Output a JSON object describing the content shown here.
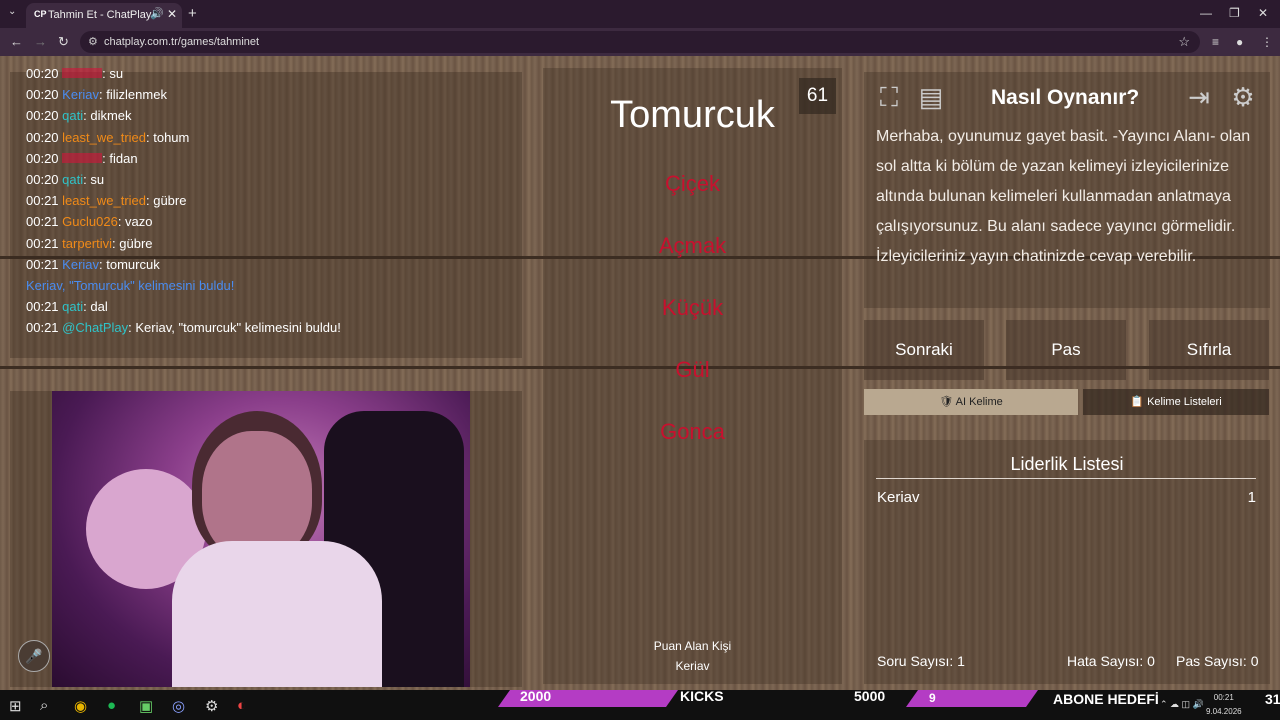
{
  "browser": {
    "tab_favicon": "CP",
    "tab_title": "Tahmin Et - ChatPlay",
    "url": "chatplay.com.tr/games/tahminet"
  },
  "chat": {
    "messages": [
      {
        "time": "00:20",
        "user": "",
        "user_color": "#d2143a",
        "text": ": su"
      },
      {
        "time": "00:20",
        "user": "Keriav",
        "user_color": "#4a8cf0",
        "text": ": filizlenmek"
      },
      {
        "time": "00:20",
        "user": "qati",
        "user_color": "#2fc3c8",
        "text": ": dikmek"
      },
      {
        "time": "00:20",
        "user": "least_we_tried",
        "user_color": "#f08a18",
        "text": ": tohum"
      },
      {
        "time": "00:20",
        "user": "",
        "user_color": "#d2143a",
        "text": ": fidan"
      },
      {
        "time": "00:20",
        "user": "qati",
        "user_color": "#2fc3c8",
        "text": ": su"
      },
      {
        "time": "00:21",
        "user": "least_we_tried",
        "user_color": "#f08a18",
        "text": ": gübre"
      },
      {
        "time": "00:21",
        "user": "Guclu026",
        "user_color": "#f08a18",
        "text": ": vazo"
      },
      {
        "time": "00:21",
        "user": "tarpertivi",
        "user_color": "#f08a18",
        "text": ": gübre"
      },
      {
        "time": "00:21",
        "user": "Keriav",
        "user_color": "#4a8cf0",
        "text": ": tomurcuk"
      },
      {
        "time": "",
        "user": "",
        "user_color": "#4a8cf0",
        "text": "Keriav, \"Tomurcuk\" kelimesini buldu!"
      },
      {
        "time": "00:21",
        "user": "qati",
        "user_color": "#2fc3c8",
        "text": ": dal"
      },
      {
        "time": "00:21",
        "user": "@ChatPlay",
        "user_color": "#2fc3c8",
        "text": ": Keriav, \"tomurcuk\" kelimesini buldu!"
      }
    ]
  },
  "game": {
    "main_word": "Tomurcuk",
    "timer": "61",
    "forbidden_words": [
      "Çiçek",
      "Açmak",
      "Küçük",
      "Gül",
      "Gonca"
    ],
    "scorer_label": "Puan Alan Kişi",
    "scorer_name": "Keriav"
  },
  "howto": {
    "title": "Nasıl Oynanır?",
    "text": "Merhaba, oyunumuz gayet basit. -Yayıncı Alanı- olan sol altta ki bölüm de yazan kelimeyi izleyicilerinize altında bulunan kelimeleri kullanmadan anlatmaya çalışıyorsunuz. Bu alanı sadece yayıncı görmelidir. İzleyicileriniz yayın chatinizde cevap verebilir."
  },
  "controls": {
    "next": "Sonraki",
    "pass": "Pas",
    "reset": "Sıfırla",
    "ai_word": "AI Kelime",
    "word_lists": "Kelime Listeleri"
  },
  "leaderboard": {
    "title": "Liderlik Listesi",
    "entries": [
      {
        "name": "Keriav",
        "score": "1"
      }
    ],
    "question_count": "Soru Sayısı: 1",
    "error_count": "Hata Sayısı: 0",
    "pass_count": "Pas Sayısı: 0"
  },
  "taskbar": {
    "goal1_value": "2000",
    "goal1_label": "KICKS",
    "goal1_target": "5000",
    "goal2_value": "9",
    "goal2_label": "ABONE HEDEFİ",
    "goal2_target": "31",
    "clock_time": "00:21",
    "clock_date": "9.04.2026"
  },
  "colors": {
    "forbidden": "#c8102e",
    "goal_bar": "#b43cc4"
  }
}
